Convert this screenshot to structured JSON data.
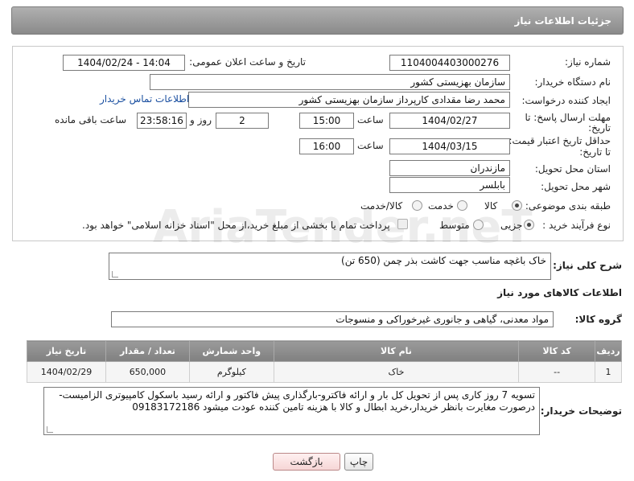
{
  "header": {
    "title": "جزئیات اطلاعات نیاز"
  },
  "form": {
    "need_number_label": "شماره نیاز:",
    "need_number": "1104004403000276",
    "announce_label": "تاریخ و ساعت اعلان عمومی:",
    "announce_value": "1404/02/24 - 14:04",
    "buyer_org_label": "نام دستگاه خریدار:",
    "buyer_org": "سازمان بهزیستی کشور",
    "creator_label": "ایجاد کننده درخواست:",
    "creator": "محمد رضا  مقدادی کارپرداز سازمان بهزیستی کشور",
    "contact_link": "اطلاعات تماس خریدار",
    "deadline_label_1": "مهلت ارسال پاسخ: تا",
    "deadline_label_2": "تاریخ:",
    "deadline_date": "1404/02/27",
    "time_label": "ساعت",
    "deadline_time": "15:00",
    "days_value": "2",
    "days_label": "روز و",
    "remaining_value": "23:58:16",
    "remaining_label": "ساعت باقی مانده",
    "validity_label_1": "حداقل تاریخ اعتبار قیمت:",
    "validity_label_2": "تا تاریخ:",
    "validity_date": "1404/03/15",
    "validity_time": "16:00",
    "province_label": "استان محل تحویل:",
    "province": "مازندران",
    "city_label": "شهر محل تحویل:",
    "city": "بابلسر",
    "category_label": "طبقه بندی موضوعی:",
    "category_options": [
      "کالا",
      "خدمت",
      "کالا/خدمت"
    ],
    "process_label": "نوع فرآیند خرید :",
    "process_options": [
      "جزیی",
      "متوسط"
    ],
    "payment_note": "پرداخت تمام یا بخشی از مبلغ خرید،از محل \"اسناد خزانه اسلامی\" خواهد بود."
  },
  "description": {
    "label": "شرح کلی نیاز:",
    "value": "خاک باغچه مناسب جهت کاشت بذر چمن (650 تن)"
  },
  "goods": {
    "section_title": "اطلاعات کالاهای مورد نیاز",
    "group_label": "گروه کالا:",
    "group_value": "مواد معدنی، گیاهی و جانوری غیرخوراکی و منسوجات",
    "columns": [
      "ردیف",
      "کد کالا",
      "نام کالا",
      "واحد شمارش",
      "تعداد / مقدار",
      "تاریخ نیاز"
    ],
    "rows": [
      [
        "1",
        "--",
        "خاک",
        "کیلوگرم",
        "650,000",
        "1404/02/29"
      ]
    ]
  },
  "buyer_notes": {
    "label": "توضیحات خریدار:",
    "value": "تسویه 7 روز کاری پس از تحویل کل بار و ارائه فاکترو-بارگذاری پیش فاکتور و ارائه رسید باسکول کامپیوتری الزامیست-درصورت مغایرت بانظر خریدار،خرید ابطال و کالا با هزینه تامین کننده عودت میشود 09183172186"
  },
  "buttons": {
    "print": "چاپ",
    "back": "بازگشت"
  },
  "watermark": "AriaTender.neT"
}
